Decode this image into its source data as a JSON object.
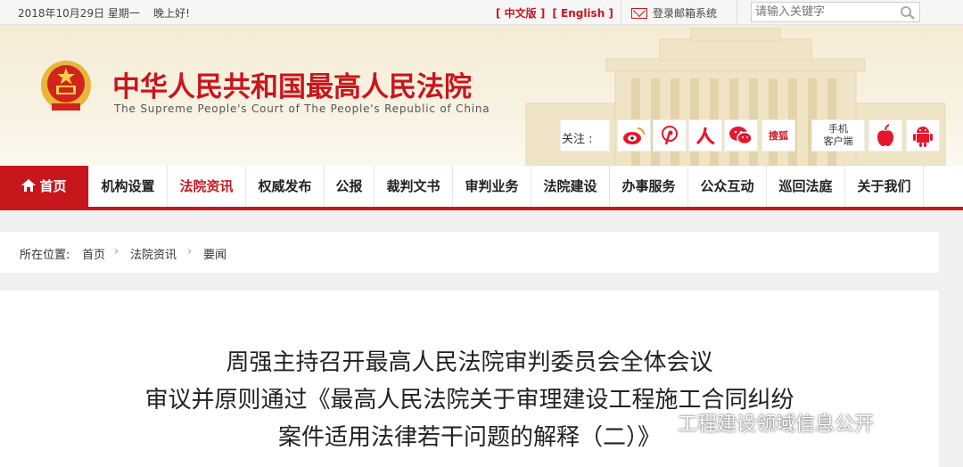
{
  "topbar": {
    "date": "2018年10月29日 星期一",
    "greeting": "晚上好!",
    "lang_cn": "[ 中文版 ]",
    "lang_en": "[ English ]",
    "mail_label": "登录邮箱系统",
    "search_placeholder": "请输入关键字"
  },
  "header": {
    "title": "中华人民共和国最高人民法院",
    "subtitle": "The Supreme People's Court of The People's Republic of China",
    "follow_label": "关注 :",
    "sohu_label": "搜狐",
    "mobile_line1": "手机",
    "mobile_line2": "客户端"
  },
  "nav": {
    "items": [
      {
        "label": "首页"
      },
      {
        "label": "机构设置"
      },
      {
        "label": "法院资讯"
      },
      {
        "label": "权威发布"
      },
      {
        "label": "公报"
      },
      {
        "label": "裁判文书"
      },
      {
        "label": "审判业务"
      },
      {
        "label": "法院建设"
      },
      {
        "label": "办事服务"
      },
      {
        "label": "公众互动"
      },
      {
        "label": "巡回法庭"
      },
      {
        "label": "关于我们"
      }
    ],
    "active_index": 2
  },
  "breadcrumb": {
    "prefix": "所在位置:",
    "items": [
      "首页",
      "法院资讯",
      "要闻"
    ]
  },
  "article": {
    "title_lines": [
      "周强主持召开最高人民法院审判委员会全体会议",
      "审议并原则通过《最高人民法院关于审理建设工程施工合同纠纷",
      "案件适用法律若干问题的解释（二）》"
    ]
  },
  "watermark": {
    "text": "工程建设领域信息公开"
  },
  "colors": {
    "brand_red": "#c8161d",
    "header_bg": "#f5ecd5"
  }
}
